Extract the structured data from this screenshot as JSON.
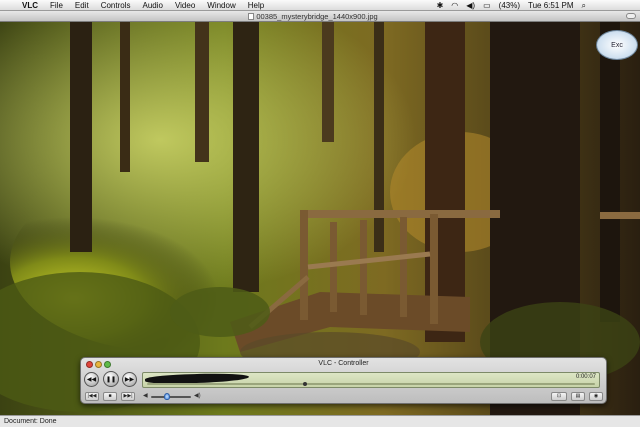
{
  "menubar": {
    "apple_icon": "apple-icon",
    "items": [
      "VLC",
      "File",
      "Edit",
      "Controls",
      "Audio",
      "Video",
      "Window",
      "Help"
    ],
    "battery_percent": "(43%)",
    "clock": "Tue 6:51 PM"
  },
  "window": {
    "title": "00385_mysterybridge_1440x900.jpg"
  },
  "expose": {
    "label": "Exc"
  },
  "controller": {
    "title": "VLC - Controller",
    "time": "0:00:07",
    "position_fraction": 0.35,
    "volume_fraction": 0.4
  },
  "statusbar": {
    "text": "Document: Done"
  },
  "colors": {
    "accent": "#3b7dd8",
    "close": "#e0443b",
    "minimize": "#e9b53c",
    "zoom": "#5fbb47"
  }
}
